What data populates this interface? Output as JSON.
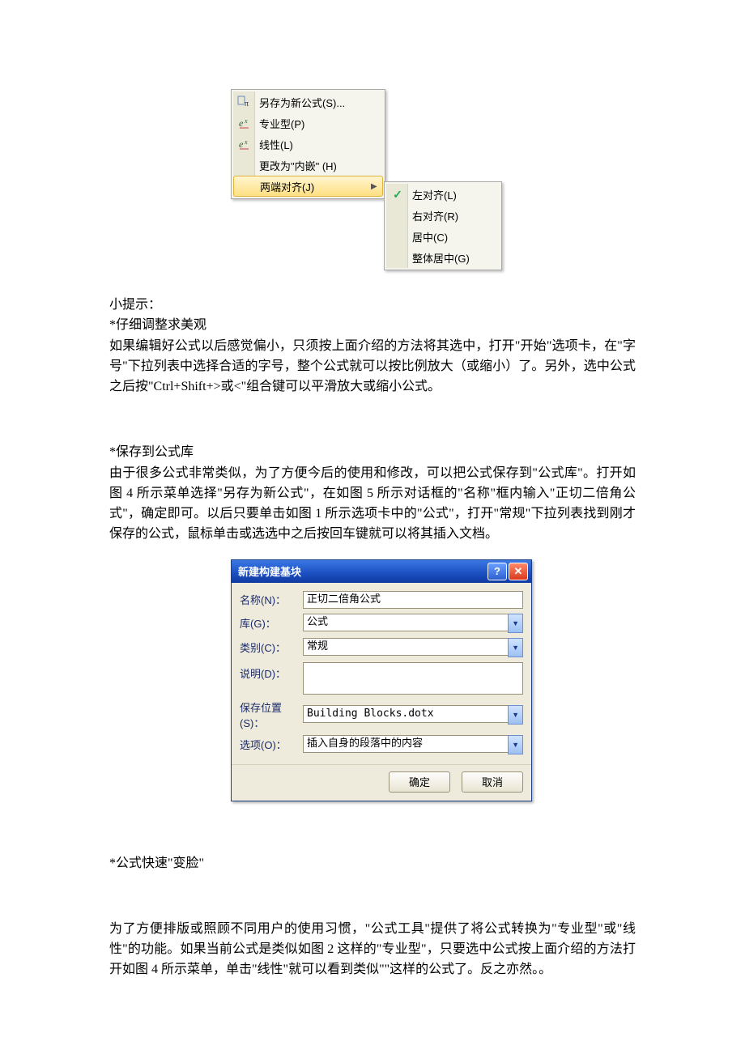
{
  "menu": {
    "save_as": "另存为新公式(S)...",
    "professional": "专业型(P)",
    "linear": "线性(L)",
    "change_inline": "更改为\"内嵌\" (H)",
    "justify": "两端对齐(J)",
    "sub_left": "左对齐(L)",
    "sub_right": "右对齐(R)",
    "sub_center": "居中(C)",
    "sub_center_group": "整体居中(G)"
  },
  "text": {
    "tip_header": "小提示：",
    "sec1_title": "*仔细调整求美观",
    "sec1_body": "如果编辑好公式以后感觉偏小，只须按上面介绍的方法将其选中，打开\"开始\"选项卡，在\"字号\"下拉列表中选择合适的字号，整个公式就可以按比例放大（或缩小）了。另外，选中公式之后按\"Ctrl+Shift+>或<\"组合键可以平滑放大或缩小公式。",
    "sec2_title": "*保存到公式库",
    "sec2_body": "由于很多公式非常类似，为了方便今后的使用和修改，可以把公式保存到\"公式库\"。打开如图 4 所示菜单选择\"另存为新公式\"，在如图 5 所示对话框的\"名称\"框内输入\"正切二倍角公式\"，确定即可。以后只要单击如图 1 所示选项卡中的\"公式\"，打开\"常规\"下拉列表找到刚才保存的公式，鼠标单击或选选中之后按回车键就可以将其插入文档。",
    "sec3_title": "*公式快速\"变脸\"",
    "sec3_body": "为了方便排版或照顾不同用户的使用习惯，\"公式工具\"提供了将公式转换为\"专业型\"或\"线性\"的功能。如果当前公式是类似如图 2 这样的\"专业型\"，只要选中公式按上面介绍的方法打开如图 4 所示菜单，单击\"线性\"就可以看到类似\"\"这样的公式了。反之亦然。。"
  },
  "dialog": {
    "title": "新建构建基块",
    "labels": {
      "name": "名称(N)：",
      "gallery": "库(G)：",
      "category": "类别(C)：",
      "desc": "说明(D)：",
      "save_in": "保存位置(S)：",
      "options": "选项(O)："
    },
    "values": {
      "name": "正切二倍角公式",
      "gallery": "公式",
      "category": "常规",
      "desc": "",
      "save_in": "Building Blocks.dotx",
      "options": "插入自身的段落中的内容"
    },
    "ok": "确定",
    "cancel": "取消"
  }
}
